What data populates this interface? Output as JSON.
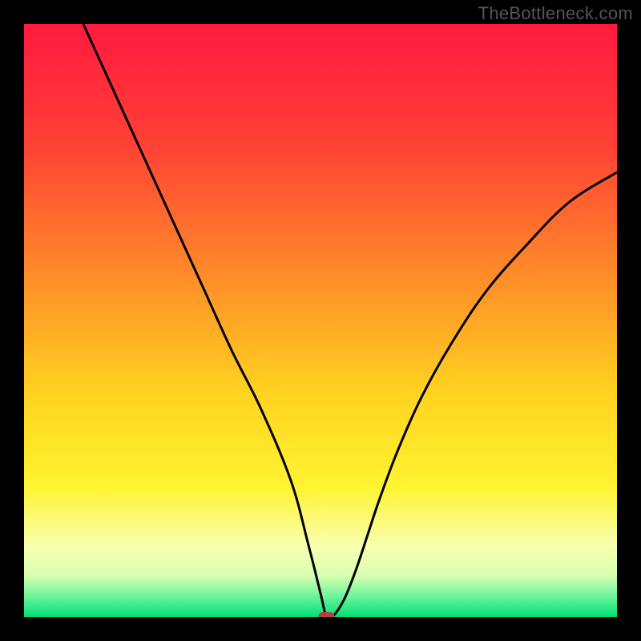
{
  "watermark": "TheBottleneck.com",
  "chart_data": {
    "type": "line",
    "title": "",
    "xlabel": "",
    "ylabel": "",
    "xlim": [
      0,
      100
    ],
    "ylim": [
      0,
      100
    ],
    "grid": false,
    "legend": false,
    "curve": {
      "name": "bottleneck",
      "x": [
        10,
        15,
        20,
        25,
        30,
        35,
        40,
        45,
        48,
        50,
        51,
        52,
        54,
        56,
        58,
        60,
        63,
        67,
        72,
        78,
        85,
        92,
        100
      ],
      "y": [
        100,
        89,
        78,
        67,
        56,
        45,
        35,
        23,
        12,
        4,
        0,
        0,
        3,
        8,
        14,
        20,
        28,
        37,
        46,
        55,
        63,
        70,
        75
      ]
    },
    "marker": {
      "name": "marker",
      "x": 51,
      "y": 0,
      "color": "#b7413b"
    },
    "background_gradient": {
      "stops": [
        {
          "offset": 0.0,
          "color": "#ff1a3f"
        },
        {
          "offset": 0.2,
          "color": "#ff4035"
        },
        {
          "offset": 0.42,
          "color": "#ff8a29"
        },
        {
          "offset": 0.62,
          "color": "#ffd21f"
        },
        {
          "offset": 0.78,
          "color": "#fff430"
        },
        {
          "offset": 0.88,
          "color": "#faffb0"
        },
        {
          "offset": 0.93,
          "color": "#d8ffb0"
        },
        {
          "offset": 0.96,
          "color": "#7cf7a0"
        },
        {
          "offset": 1.0,
          "color": "#00e077"
        }
      ]
    }
  }
}
